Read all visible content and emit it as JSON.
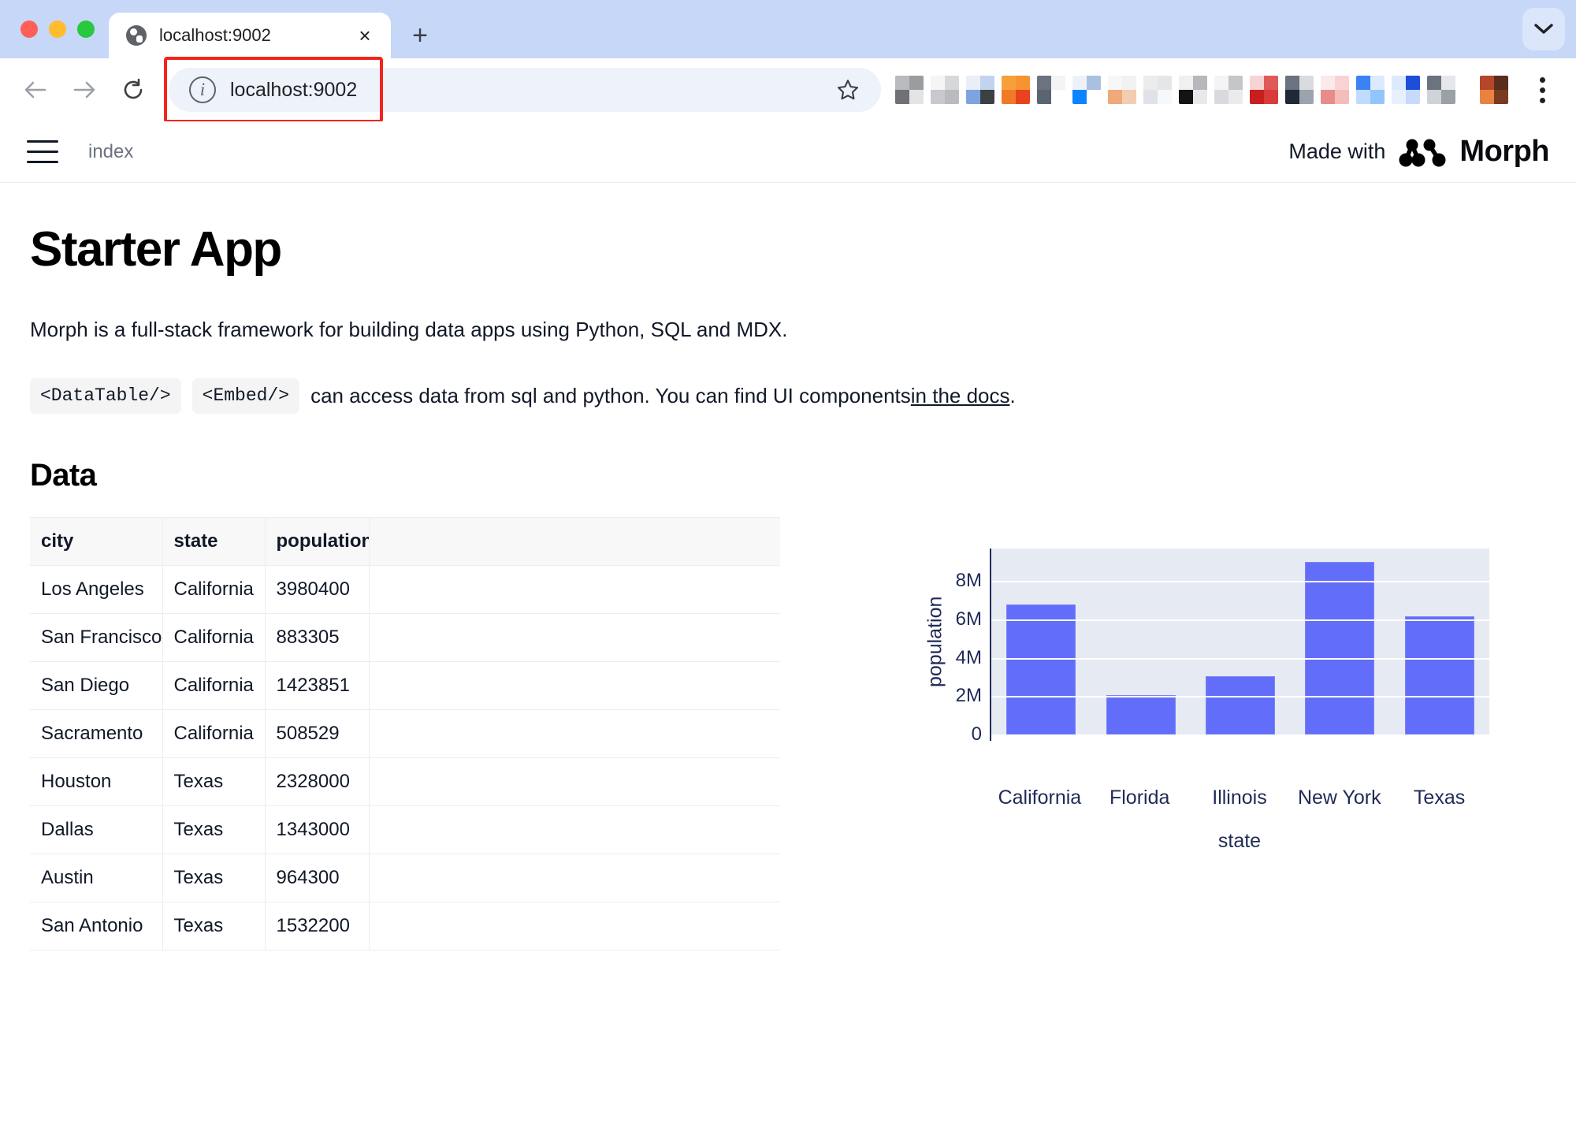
{
  "browser": {
    "tab": {
      "title": "localhost:9002",
      "favicon": "globe-icon",
      "close": "×"
    },
    "new_tab": "+",
    "tab_list_chevron": "⌄",
    "back": "←",
    "forward": "→",
    "reload": "↻",
    "omnibox": {
      "url": "localhost:9002",
      "info_icon": "i",
      "bookmark_icon": "star-icon",
      "highlighted": true,
      "highlight_color": "#f2241f"
    },
    "extensions": [
      {
        "name": "extension-1",
        "colors": [
          "#b8babd",
          "#9a9ca0",
          "#6f7175",
          "#e3e4e6"
        ]
      },
      {
        "name": "extension-2",
        "colors": [
          "#f5f5f6",
          "#d6d8da",
          "#c7c9cc",
          "#b9bbbe"
        ]
      },
      {
        "name": "extension-3",
        "colors": [
          "#e9eef7",
          "#c2d3ef",
          "#7da3e0",
          "#3c4043"
        ]
      },
      {
        "name": "extension-4",
        "colors": [
          "#f6a03c",
          "#f59430",
          "#f07a28",
          "#e8421f"
        ]
      },
      {
        "name": "extension-5",
        "colors": [
          "#6b7280",
          "#f3f4f6",
          "#5b6472",
          "#ffffff"
        ]
      },
      {
        "name": "extension-6",
        "colors": [
          "#eef2f8",
          "#a9c0e0",
          "#0a84ff",
          "#ffffff"
        ]
      },
      {
        "name": "extension-7",
        "colors": [
          "#f7f7f7",
          "#f2f2f2",
          "#efa97a",
          "#f3cdb0"
        ]
      },
      {
        "name": "extension-8",
        "colors": [
          "#ececec",
          "#e4e6ea",
          "#dfe2e6",
          "#f7f8f9"
        ]
      },
      {
        "name": "extension-9",
        "colors": [
          "#f0f0f0",
          "#b6b8bb",
          "#141414",
          "#e8e9eb"
        ]
      },
      {
        "name": "extension-10",
        "colors": [
          "#f4f4f4",
          "#c4c6c9",
          "#d8dadd",
          "#eaebed"
        ]
      },
      {
        "name": "extension-11",
        "colors": [
          "#f7d4d4",
          "#e05a5a",
          "#c81e1e",
          "#d93a3a"
        ]
      },
      {
        "name": "extension-12",
        "colors": [
          "#6b7280",
          "#d9dbde",
          "#1f2937",
          "#9ca3af"
        ]
      },
      {
        "name": "extension-13",
        "colors": [
          "#fbeaea",
          "#f9d3d3",
          "#e88b8b",
          "#f5bcbc"
        ]
      },
      {
        "name": "extension-14",
        "colors": [
          "#3b82f6",
          "#dbeafe",
          "#bfdbfe",
          "#93c5fd"
        ]
      },
      {
        "name": "extension-15",
        "colors": [
          "#dbeafe",
          "#1d4ed8",
          "#e8f0fe",
          "#c7dafc"
        ]
      },
      {
        "name": "extension-16",
        "colors": [
          "#6b7280",
          "#e5e7eb",
          "#cfd2d6",
          "#9aa0a6"
        ]
      },
      {
        "name": "extension-17",
        "colors": [
          "#b4462a",
          "#5b2d1c",
          "#e8833f",
          "#7a3a20"
        ]
      }
    ],
    "menu": "kebab-menu-icon"
  },
  "app": {
    "header": {
      "menu_label": "hamburger-menu",
      "breadcrumb": "index",
      "made_with": "Made with",
      "brand": "Morph",
      "logo": "morph-logo"
    },
    "title": "Starter App",
    "lede": "Morph is a full-stack framework for building data apps using Python, SQL and MDX.",
    "tagline": {
      "chip1": "<DataTable/>",
      "chip2": "<Embed/>",
      "text_before": "can access data from sql and python. You can find UI components ",
      "link": "in the docs",
      "text_after": "."
    },
    "section_title": "Data",
    "table": {
      "columns": [
        "city",
        "state",
        "population",
        ""
      ],
      "rows": [
        [
          "Los Angeles",
          "California",
          "3980400",
          ""
        ],
        [
          "San Francisco",
          "California",
          "883305",
          ""
        ],
        [
          "San Diego",
          "California",
          "1423851",
          ""
        ],
        [
          "Sacramento",
          "California",
          "508529",
          ""
        ],
        [
          "Houston",
          "Texas",
          "2328000",
          ""
        ],
        [
          "Dallas",
          "Texas",
          "1343000",
          ""
        ],
        [
          "Austin",
          "Texas",
          "964300",
          ""
        ],
        [
          "San Antonio",
          "Texas",
          "1532200",
          ""
        ]
      ]
    }
  },
  "chart_data": {
    "type": "bar",
    "title": "",
    "xlabel": "state",
    "ylabel": "population",
    "categories": [
      "California",
      "Florida",
      "Illinois",
      "New York",
      "Texas"
    ],
    "values": [
      6795885,
      2046000,
      3050000,
      9000000,
      6167500
    ],
    "ylim": [
      0,
      9700000
    ],
    "ytick_values": [
      0,
      2000000,
      4000000,
      6000000,
      8000000
    ],
    "ytick_labels": [
      "0",
      "2M",
      "4M",
      "6M",
      "8M"
    ],
    "grid": true,
    "legend": "none",
    "bar_color": "#626dfa",
    "plot_background": "#e6ebf3",
    "axis_color": "#1f2a56"
  }
}
